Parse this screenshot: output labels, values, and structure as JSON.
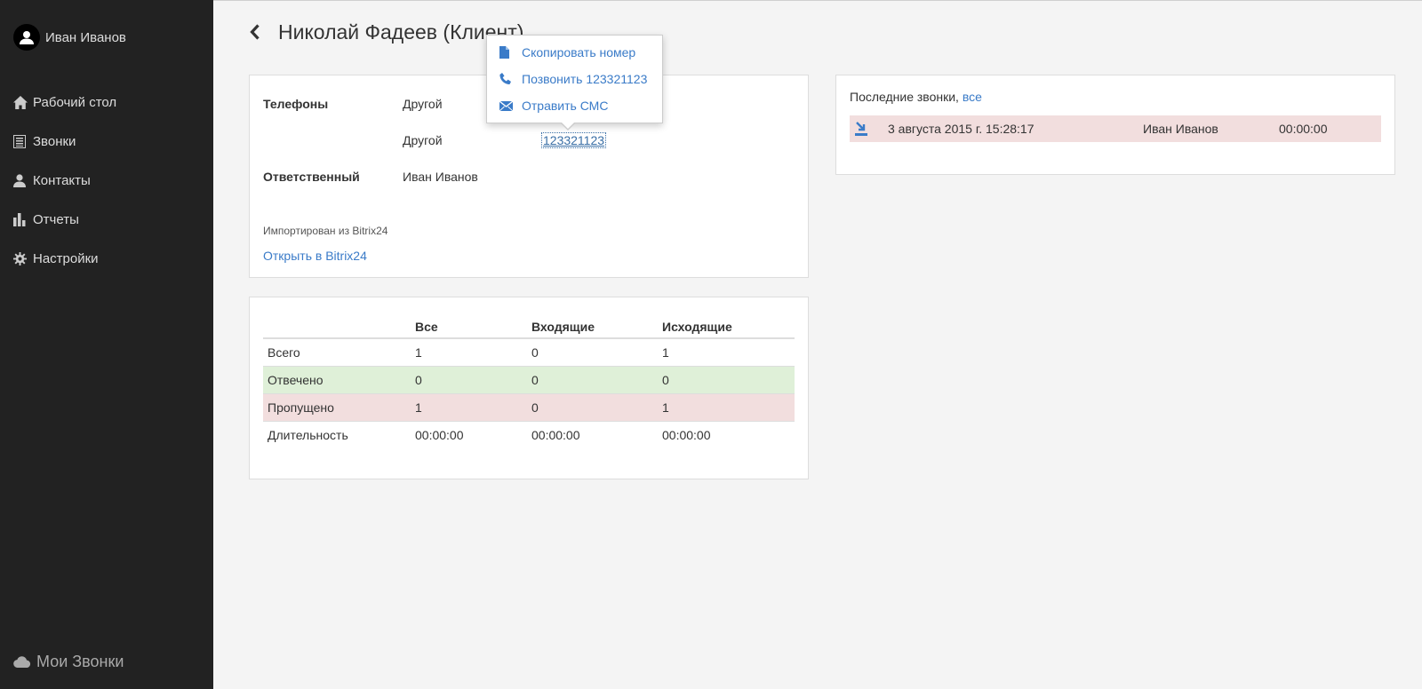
{
  "sidebar": {
    "user_name": "Иван Иванов",
    "items": [
      {
        "label": "Рабочий стол",
        "icon": "home-icon"
      },
      {
        "label": "Звонки",
        "icon": "list-icon"
      },
      {
        "label": "Контакты",
        "icon": "user-icon"
      },
      {
        "label": "Отчеты",
        "icon": "bar-chart-icon"
      },
      {
        "label": "Настройки",
        "icon": "gear-icon"
      }
    ],
    "brand": "Мои Звонки"
  },
  "header": {
    "title": "Николай Фадеев (Клиент)"
  },
  "contact": {
    "phones_label": "Телефоны",
    "phones": [
      {
        "type": "Другой",
        "number": ""
      },
      {
        "type": "Другой",
        "number": "123321123"
      }
    ],
    "responsible_label": "Ответственный",
    "responsible": "Иван Иванов",
    "imported_text": "Импортирован из Bitrix24",
    "open_link": "Открыть в Bitrix24"
  },
  "popover": {
    "items": [
      {
        "label": "Скопировать номер",
        "icon": "file-icon"
      },
      {
        "label": "Позвонить 123321123",
        "icon": "phone-icon"
      },
      {
        "label": "Отравить СМС",
        "icon": "envelope-icon"
      }
    ]
  },
  "stats": {
    "headers": [
      "",
      "Все",
      "Входящие",
      "Исходящие"
    ],
    "rows": [
      {
        "label": "Всего",
        "cells": [
          "1",
          "0",
          "1"
        ]
      },
      {
        "label": "Отвечено",
        "cells": [
          "0",
          "0",
          "0"
        ]
      },
      {
        "label": "Пропущено",
        "cells": [
          "1",
          "0",
          "1"
        ]
      },
      {
        "label": "Длительность",
        "cells": [
          "00:00:00",
          "00:00:00",
          "00:00:00"
        ]
      }
    ]
  },
  "recent_calls": {
    "title": "Последние звонки,",
    "all_link": "все",
    "calls": [
      {
        "date": "3 августа 2015 г. 15:28:17",
        "user": "Иван Иванов",
        "duration": "00:00:00",
        "icon": "outgoing-call-icon"
      }
    ]
  },
  "colors": {
    "sidebar_bg": "#222222",
    "link": "#3a7bc8",
    "answered_bg": "#dff0d8",
    "missed_bg": "#f2dede"
  }
}
